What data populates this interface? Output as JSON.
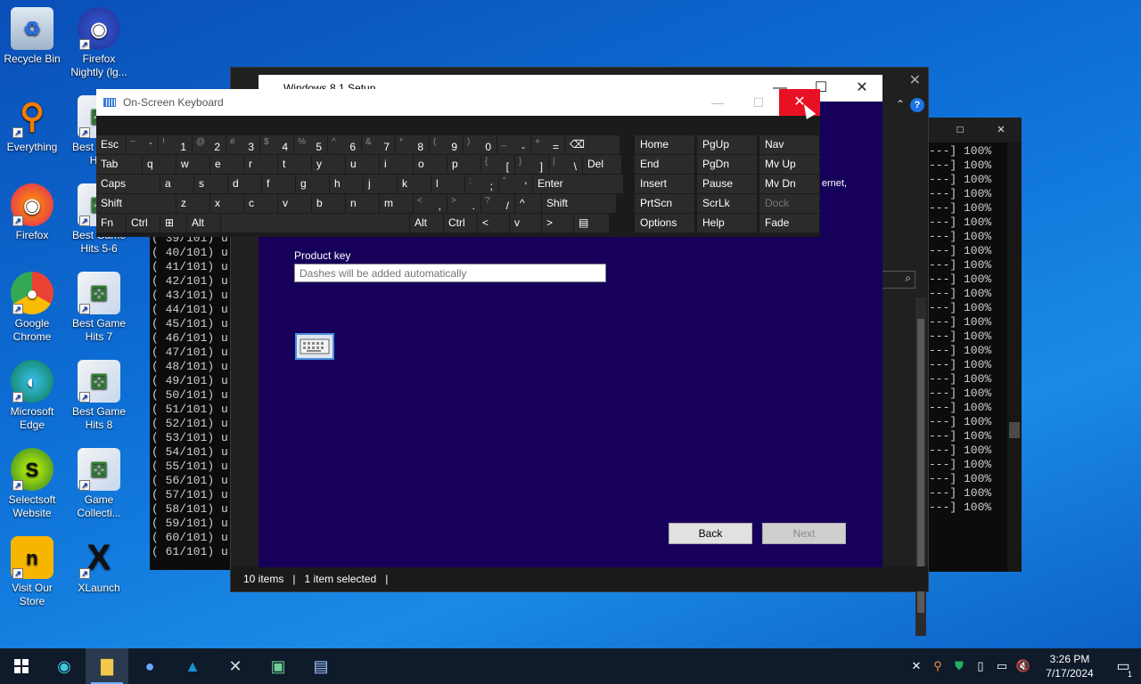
{
  "desktop": {
    "icons": [
      {
        "label": "Recycle Bin",
        "icon": "recycle-bin-icon"
      },
      {
        "label": "Firefox Nightly (lg...",
        "icon": "firefox-nightly-icon"
      },
      {
        "label": "Everything",
        "icon": "everything-search-icon"
      },
      {
        "label": "Best Game Hits",
        "icon": "dice-icon"
      },
      {
        "label": "Firefox",
        "icon": "firefox-icon"
      },
      {
        "label": "Best Game Hits 5-6",
        "icon": "dice-icon"
      },
      {
        "label": "Google Chrome",
        "icon": "chrome-icon"
      },
      {
        "label": "Best Game Hits 7",
        "icon": "dice-icon"
      },
      {
        "label": "Microsoft Edge",
        "icon": "edge-icon"
      },
      {
        "label": "Best Game Hits 8",
        "icon": "dice-icon"
      },
      {
        "label": "Selectsoft Website",
        "icon": "selectsoft-icon"
      },
      {
        "label": "Game Collecti...",
        "icon": "dice-icon"
      },
      {
        "label": "Visit Our Store",
        "icon": "store-icon"
      },
      {
        "label": "XLaunch",
        "icon": "xlaunch-icon"
      }
    ]
  },
  "console_left": {
    "lines": [
      "( 39/101) u",
      "( 40/101) u",
      "( 41/101) u",
      "( 42/101) u",
      "( 43/101) u",
      "( 44/101) u",
      "( 45/101) u",
      "( 46/101) u",
      "( 47/101) u",
      "( 48/101) u",
      "( 49/101) u",
      "( 50/101) u",
      "( 51/101) u",
      "( 52/101) u",
      "( 53/101) u",
      "( 54/101) u",
      "( 55/101) u",
      "( 56/101) u",
      "( 57/101) u",
      "( 58/101) u",
      "( 59/101) u",
      "( 60/101) u",
      "( 61/101) u"
    ]
  },
  "console_right": {
    "line": "---] 100%",
    "count": 26
  },
  "explorer": {
    "status_items": "10 items",
    "status_selected": "1 item selected"
  },
  "setup": {
    "title": "Windows 8.1 Setup",
    "cut_text": "ernet,",
    "product_key_label": "Product key",
    "product_key_placeholder": "Dashes will be added automatically",
    "back_label": "Back",
    "next_label": "Next"
  },
  "osk": {
    "title": "On-Screen Keyboard",
    "rows": [
      [
        {
          "main": "Esc",
          "w": 34
        },
        {
          "shift": "~",
          "main": "`",
          "w": 36
        },
        {
          "shift": "!",
          "main": "1",
          "w": 38
        },
        {
          "shift": "@",
          "main": "2",
          "w": 38
        },
        {
          "shift": "#",
          "main": "3",
          "w": 38
        },
        {
          "shift": "$",
          "main": "4",
          "w": 38
        },
        {
          "shift": "%",
          "main": "5",
          "w": 38
        },
        {
          "shift": "^",
          "main": "6",
          "w": 38
        },
        {
          "shift": "&",
          "main": "7",
          "w": 38
        },
        {
          "shift": "*",
          "main": "8",
          "w": 38
        },
        {
          "shift": "(",
          "main": "9",
          "w": 38
        },
        {
          "shift": ")",
          "main": "0",
          "w": 38
        },
        {
          "shift": "_",
          "main": "-",
          "w": 38
        },
        {
          "shift": "+",
          "main": "=",
          "w": 38
        },
        {
          "main": "⌫",
          "w": 62
        }
      ],
      [
        {
          "main": "Tab",
          "w": 52
        },
        {
          "main": "q",
          "w": 38
        },
        {
          "main": "w",
          "w": 38
        },
        {
          "main": "e",
          "w": 38
        },
        {
          "main": "r",
          "w": 38
        },
        {
          "main": "t",
          "w": 38
        },
        {
          "main": "y",
          "w": 38
        },
        {
          "main": "u",
          "w": 38
        },
        {
          "main": "i",
          "w": 38
        },
        {
          "main": "o",
          "w": 38
        },
        {
          "main": "p",
          "w": 38
        },
        {
          "shift": "{",
          "main": "[",
          "w": 38
        },
        {
          "shift": "}",
          "main": "]",
          "w": 38
        },
        {
          "shift": "|",
          "main": "\\",
          "w": 38
        },
        {
          "main": "Del",
          "w": 44
        }
      ],
      [
        {
          "main": "Caps",
          "w": 72
        },
        {
          "main": "a",
          "w": 38
        },
        {
          "main": "s",
          "w": 38
        },
        {
          "main": "d",
          "w": 38
        },
        {
          "main": "f",
          "w": 38
        },
        {
          "main": "g",
          "w": 38
        },
        {
          "main": "h",
          "w": 38
        },
        {
          "main": "j",
          "w": 38
        },
        {
          "main": "k",
          "w": 38
        },
        {
          "main": "l",
          "w": 38
        },
        {
          "shift": ":",
          "main": ";",
          "w": 38
        },
        {
          "shift": "\"",
          "main": "'",
          "w": 38
        },
        {
          "main": "Enter",
          "w": 102
        }
      ],
      [
        {
          "main": "Shift",
          "w": 90
        },
        {
          "main": "z",
          "w": 38
        },
        {
          "main": "x",
          "w": 38
        },
        {
          "main": "c",
          "w": 38
        },
        {
          "main": "v",
          "w": 38
        },
        {
          "main": "b",
          "w": 38
        },
        {
          "main": "n",
          "w": 38
        },
        {
          "main": "m",
          "w": 38
        },
        {
          "shift": "<",
          "main": ",",
          "w": 38
        },
        {
          "shift": ">",
          "main": ".",
          "w": 38
        },
        {
          "shift": "?",
          "main": "/",
          "w": 38
        },
        {
          "main": "^",
          "w": 30
        },
        {
          "main": "Shift",
          "w": 84
        }
      ],
      [
        {
          "main": "Fn",
          "w": 34
        },
        {
          "main": "Ctrl",
          "w": 38
        },
        {
          "main": "⊞",
          "w": 30
        },
        {
          "main": "Alt",
          "w": 38
        },
        {
          "main": "",
          "w": 212
        },
        {
          "main": "Alt",
          "w": 38
        },
        {
          "main": "Ctrl",
          "w": 38
        },
        {
          "main": "<",
          "w": 36
        },
        {
          "main": "v",
          "w": 36
        },
        {
          "main": ">",
          "w": 36
        },
        {
          "main": "▤",
          "w": 40
        }
      ]
    ],
    "nav": [
      [
        "Home",
        "PgUp",
        "Nav"
      ],
      [
        "End",
        "PgDn",
        "Mv Up"
      ],
      [
        "Insert",
        "Pause",
        "Mv Dn"
      ],
      [
        "PrtScn",
        "ScrLk",
        "Dock"
      ],
      [
        "Options",
        "Help",
        "Fade"
      ]
    ]
  },
  "taskbar": {
    "apps": [
      "start-icon",
      "edge-icon",
      "file-explorer-icon",
      "firefox-nightly-icon",
      "arch-icon",
      "xlaunch-icon",
      "setup-icon",
      "network-config-icon"
    ],
    "time": "3:26 PM",
    "date": "7/17/2024",
    "notification_count": "1"
  }
}
